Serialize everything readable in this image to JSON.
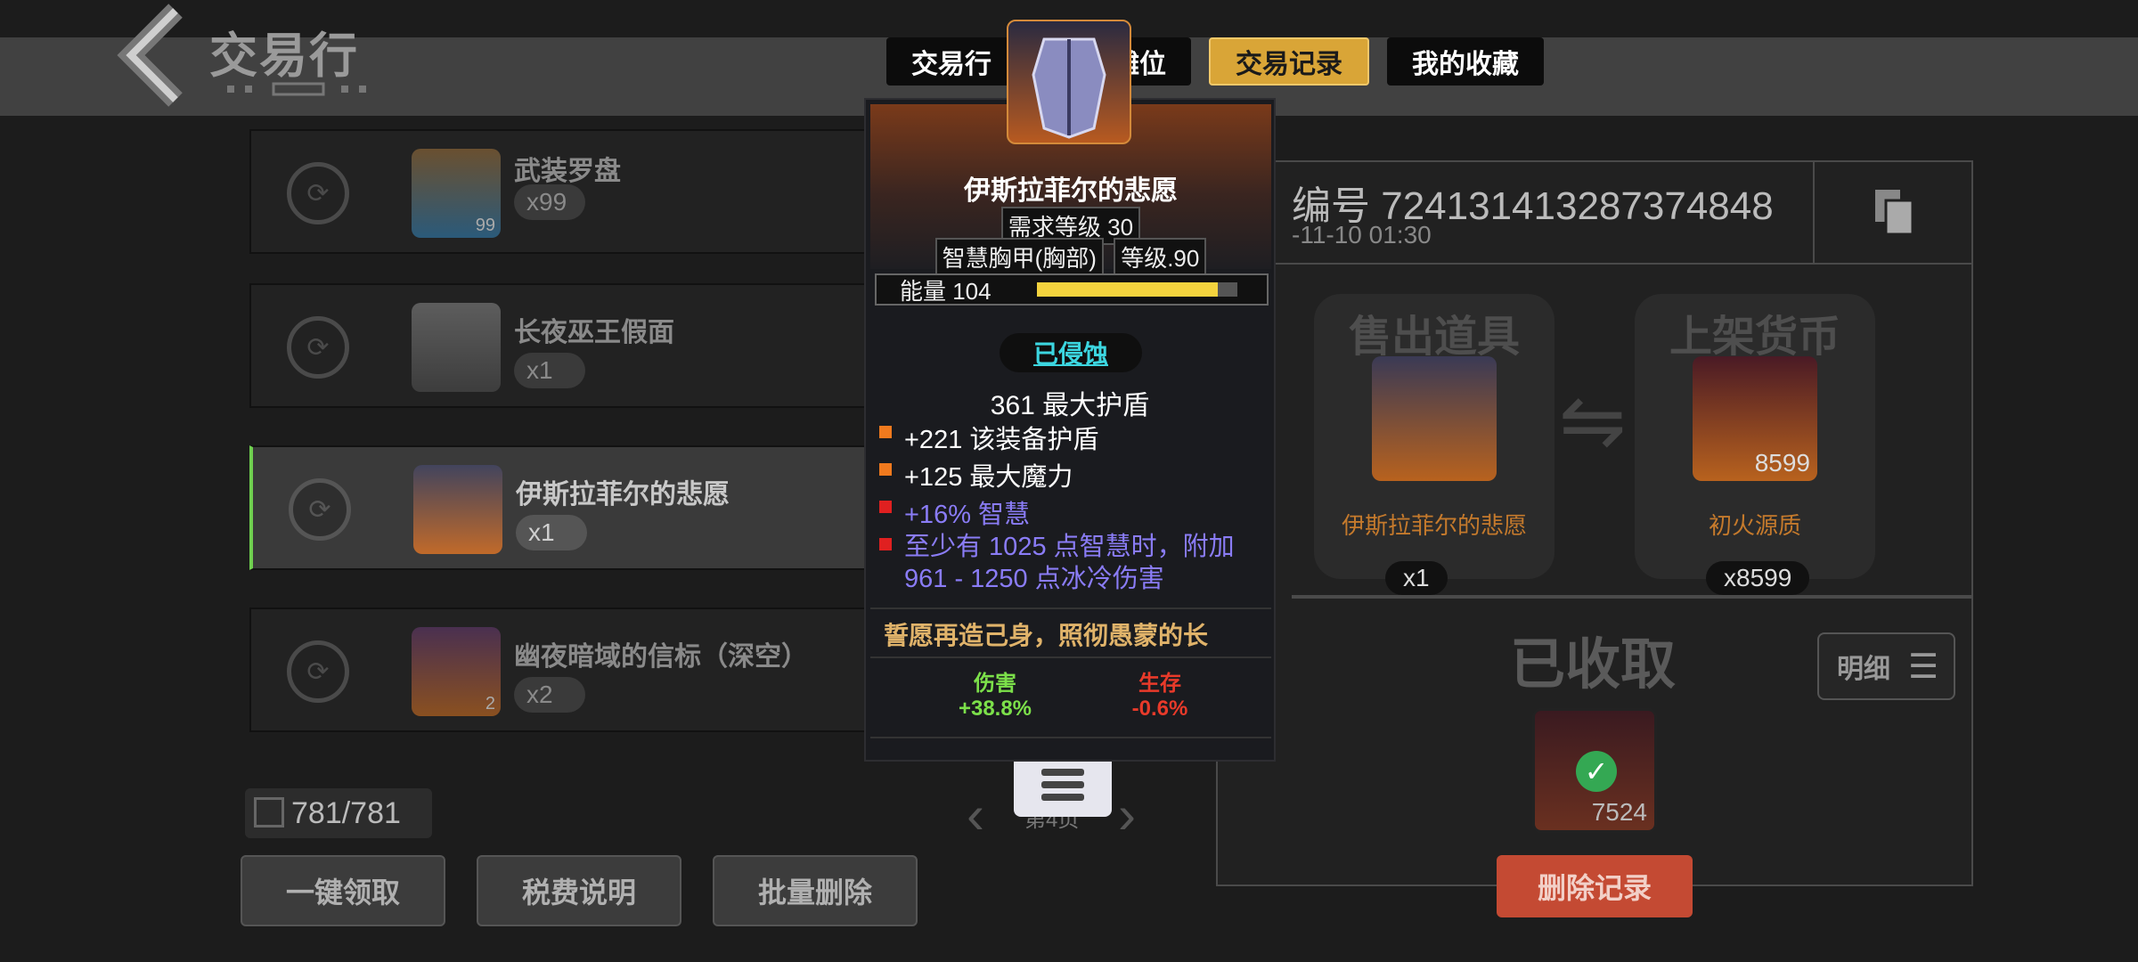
{
  "header": {
    "title": "交易行",
    "tabs": [
      {
        "label": "交易行",
        "active": false
      },
      {
        "label": "我的摊位",
        "active": false
      },
      {
        "label": "交易记录",
        "active": true
      },
      {
        "label": "我的收藏",
        "active": false
      }
    ]
  },
  "list": {
    "items": [
      {
        "name": "武装罗盘",
        "qty": "x99",
        "thumb_count": "99",
        "selected": false
      },
      {
        "name": "长夜巫王假面",
        "qty": "x1",
        "thumb_count": "",
        "selected": false
      },
      {
        "name": "伊斯拉菲尔的悲愿",
        "qty": "x1",
        "thumb_count": "",
        "selected": true
      },
      {
        "name": "幽夜暗域的信标（深空）",
        "qty": "x2",
        "thumb_count": "2",
        "selected": false
      }
    ],
    "counter": "781/781"
  },
  "bottom_buttons": {
    "claim_all": "一键领取",
    "tax_info": "税费说明",
    "batch_delete": "批量删除"
  },
  "pager": {
    "page_label": "第4页"
  },
  "record": {
    "id_label": "编号 724131413287374848",
    "date": "-11-10 01:30",
    "sold_title": "售出道具",
    "sold_item_name": "伊斯拉菲尔的悲愿",
    "sold_qty": "x1",
    "currency_title": "上架货币",
    "currency_name": "初火源质",
    "currency_count": "8599",
    "currency_qty": "x8599",
    "collected_title": "已收取",
    "collected_count": "7524",
    "detail_label": "明细",
    "delete_label": "删除记录"
  },
  "tooltip": {
    "name": "伊斯拉菲尔的悲愿",
    "req_level": "需求等级 30",
    "type": "智慧胸甲(胸部)",
    "item_level": "等级.90",
    "energy_label": "能量 104",
    "energy_fraction": 0.9,
    "status": "已侵蚀",
    "main_stat": "361 最大护盾",
    "stats": [
      {
        "text": "+221 该装备护盾",
        "color": "#ffffff",
        "dot": "#f07a1e"
      },
      {
        "text": "+125 最大魔力",
        "color": "#ffffff",
        "dot": "#f07a1e"
      },
      {
        "text": "+16% 智慧",
        "color": "#8a7cf6",
        "dot": "#e02020"
      },
      {
        "text": "至少有 1025 点智慧时，附加\n961 - 1250 点冰冷伤害",
        "color": "#8a7cf6",
        "dot": "#e02020"
      }
    ],
    "flavor": "誓愿再造己身，照彻愚蒙的长",
    "damage_label": "伤害",
    "damage_value": "+38.8%",
    "survive_label": "生存",
    "survive_value": "-0.6%"
  },
  "colors": {
    "accent": "#d9a537",
    "delete": "#c44a33",
    "status_cyan": "#3cd6e0",
    "damage_green": "#7ce04a",
    "survive_red": "#e83a2a"
  }
}
